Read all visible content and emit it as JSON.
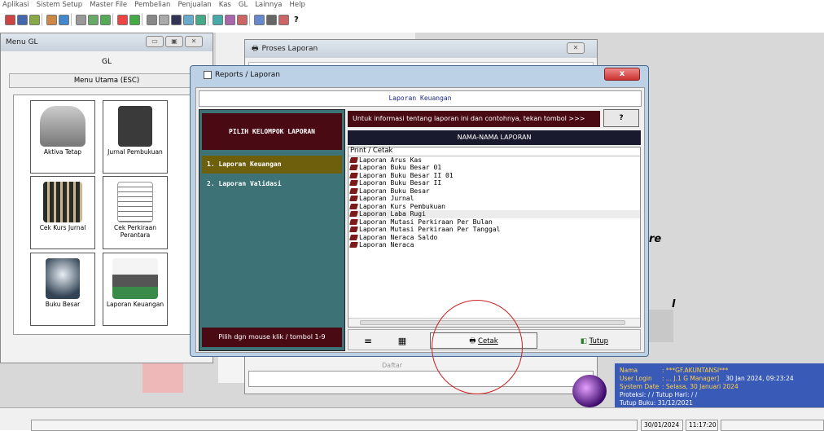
{
  "menubar": [
    "Aplikasi",
    "Sistem Setup",
    "Master File",
    "Pembelian",
    "Penjualan",
    "Kas",
    "GL",
    "Lainnya",
    "Help"
  ],
  "toolbar": {
    "help": "?"
  },
  "menu_gl": {
    "title": "Menu GL",
    "header": "GL",
    "subheader": "Menu Utama (ESC)",
    "items": [
      {
        "label": "Aktiva Tetap"
      },
      {
        "label": "Jurnal Pembukuan"
      },
      {
        "label": "Cek Kurs Jurnal"
      },
      {
        "label": "Cek Perkiraan Perantara"
      },
      {
        "label": "Buku Besar"
      },
      {
        "label": "Laporan Keuangan"
      }
    ]
  },
  "proses": {
    "title": "Proses Laporan",
    "behind_label": "Daftar"
  },
  "dialog": {
    "title": "Reports / Laporan",
    "close": "x",
    "heading": "Laporan Keuangan",
    "group_header": "PILIH KELOMPOK LAPORAN",
    "groups": [
      "1. Laporan Keuangan",
      "2. Laporan Validasi"
    ],
    "footer_hint": "Pilih dgn mouse klik / tombol 1-9",
    "info_text": "Untuk informasi tentang laporan ini dan contohnya, tekan tombol >>>",
    "info_button": "?",
    "names_header": "NAMA-NAMA LAPORAN",
    "list_caption": "Print / Cetak",
    "reports": [
      "Laporan Arus Kas",
      "Laporan Buku Besar 01",
      "Laporan Buku Besar II 01",
      "Laporan Buku Besar II",
      "Laporan Buku Besar",
      "Laporan Jurnal",
      "Laporan Kurs Pembukuan",
      "Laporan Laba Rugi",
      "Laporan Mutasi Perkiraan Per Bulan",
      "Laporan Mutasi Perkiraan Per Tanggal",
      "Laporan Neraca Saldo",
      "Laporan Neraca"
    ],
    "buttons": {
      "equals": "=",
      "cetak": "Cetak",
      "tutup": "Tutup"
    }
  },
  "info": {
    "nama_label": "Nama",
    "nama_value": ": ***GF.AKUNTANSI***",
    "user_label": "User Login",
    "user_value": ": ... J.1 G Manager]",
    "user_time": "30 Jan 2024, 09:23:24",
    "sysdate_label": "System Date",
    "sysdate_value": ": Selasa, 30 Januari 2024",
    "proteksi": "Proteksi:  / /      Tutup Hari:  / /",
    "tutup_buku": "Tutup Buku: 31/12/2021"
  },
  "side_fragments": {
    "a": "re",
    "b": "l"
  },
  "statusbar": {
    "date": "30/01/2024",
    "time": "11:17:20"
  }
}
